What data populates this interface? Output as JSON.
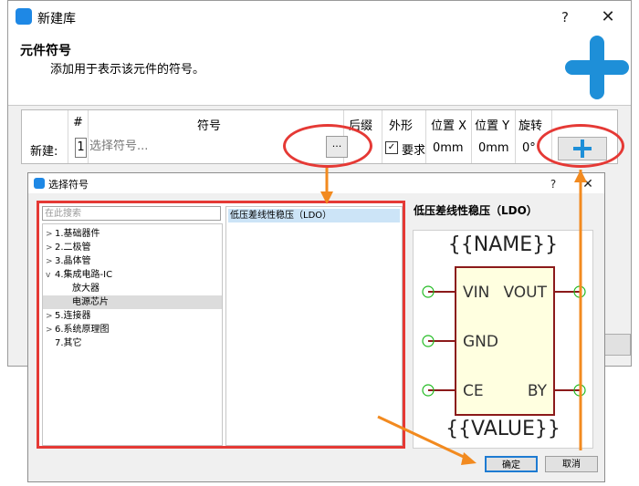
{
  "colors": {
    "accent": "#1e8fd8",
    "annotation_red": "#e53935",
    "annotation_orange": "#f28a1f",
    "selection_blue": "#cce4f7",
    "symbol_fill": "#ffffe0",
    "symbol_border": "#8b1a1a",
    "pin_dot": "#22bb22"
  },
  "main_dialog": {
    "title": "新建库",
    "help": "?",
    "close": "✕",
    "section_title": "元件符号",
    "section_desc": "添加用于表示该元件的符号。",
    "grid": {
      "headers": [
        "#",
        "符号",
        "后缀",
        "外形",
        "位置 X",
        "位置 Y",
        "旋转"
      ],
      "row_label": "新建:",
      "row_index": "1",
      "symbol_placeholder": "选择符号...",
      "browse_label": "...",
      "shape_check": "☑",
      "shape_value": "要求",
      "pos_x": "0mm",
      "pos_y": "0mm",
      "rotation": "0°"
    }
  },
  "child_dialog": {
    "title": "选择符号",
    "help": "?",
    "close": "✕",
    "search_placeholder": "在此搜索",
    "tree": [
      {
        "label": "1.基础器件",
        "arrow": ">",
        "level": 0
      },
      {
        "label": "2.二极管",
        "arrow": ">",
        "level": 0
      },
      {
        "label": "3.晶体管",
        "arrow": ">",
        "level": 0
      },
      {
        "label": "4.集成电路-IC",
        "arrow": "v",
        "level": 0
      },
      {
        "label": "放大器",
        "arrow": "",
        "level": 1
      },
      {
        "label": "电源芯片",
        "arrow": "",
        "level": 1,
        "selected": true
      },
      {
        "label": "5.连接器",
        "arrow": ">",
        "level": 0
      },
      {
        "label": "6.系统原理图",
        "arrow": ">",
        "level": 0
      },
      {
        "label": "7.其它",
        "arrow": "",
        "level": 0
      }
    ],
    "list_items": [
      "低压差线性稳压（LDO）"
    ],
    "preview_title": "低压差线性稳压（LDO）",
    "symbol": {
      "name": "{{NAME}}",
      "value": "{{VALUE}}",
      "pins": {
        "vin": "VIN",
        "vout": "VOUT",
        "gnd": "GND",
        "ce": "CE",
        "by": "BY"
      }
    },
    "ok": "确定",
    "cancel": "取消"
  }
}
